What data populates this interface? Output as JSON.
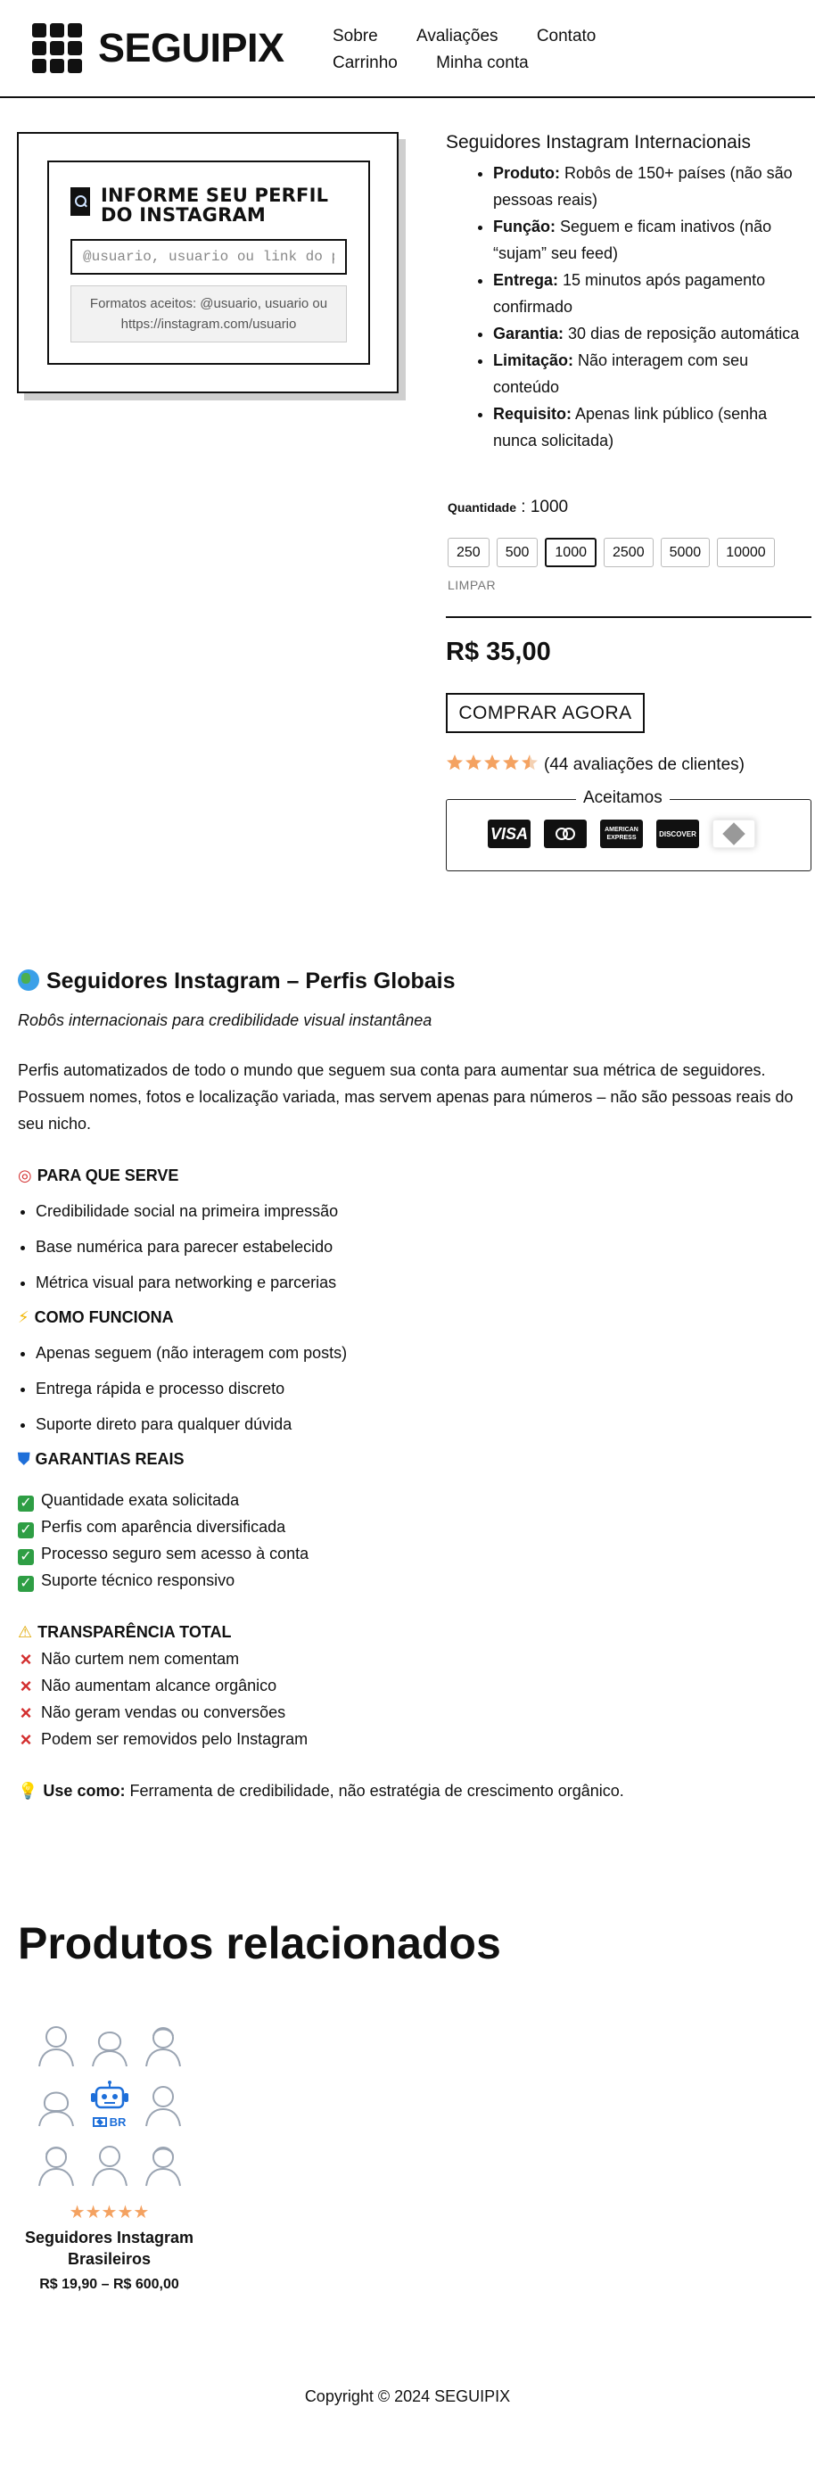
{
  "header": {
    "brand": "SEGUIPIX",
    "nav": [
      "Sobre",
      "Avaliações",
      "Contato",
      "Carrinho",
      "Minha conta"
    ]
  },
  "profile_box": {
    "title": "INFORME SEU PERFIL DO INSTAGRAM",
    "input_placeholder": "@usuario, usuario ou link do perfil",
    "formats_line1": "Formatos aceitos: @usuario, usuario ou",
    "formats_line2": "https://instagram.com/usuario"
  },
  "product": {
    "title": "Seguidores Instagram Internacionais",
    "features": [
      {
        "label": "Produto:",
        "text": "Robôs de 150+ países (não são pessoas reais)"
      },
      {
        "label": "Função:",
        "text": "Seguem e ficam inativos (não “sujam” seu feed)"
      },
      {
        "label": "Entrega:",
        "text": "15 minutos após pagamento confirmado"
      },
      {
        "label": "Garantia:",
        "text": "30 dias de reposição automática"
      },
      {
        "label": "Limitação:",
        "text": "Não interagem com seu conteúdo"
      },
      {
        "label": "Requisito:",
        "text": "Apenas link público (senha nunca solicitada)"
      }
    ],
    "quantity_label": "Quantidade",
    "quantity_value": "1000",
    "quantity_options": [
      "250",
      "500",
      "1000",
      "2500",
      "5000",
      "10000"
    ],
    "selected_quantity": "1000",
    "clear_label": "LIMPAR",
    "price": "R$ 35,00",
    "buy_label": "COMPRAR AGORA",
    "rating_stars": 4.5,
    "rating_text": "(44 avaliações de clientes)",
    "accept_title": "Aceitamos",
    "payment_cards": [
      {
        "name": "visa-card-icon",
        "text": "VISA"
      },
      {
        "name": "mastercard-icon",
        "text": "MasterCard"
      },
      {
        "name": "amex-card-icon",
        "text": "AMERICAN EXPRESS"
      },
      {
        "name": "discover-card-icon",
        "text": "DISCOVER"
      },
      {
        "name": "pix-icon",
        "text": ""
      }
    ]
  },
  "description": {
    "heading": "Seguidores Instagram – Perfis Globais",
    "tagline": "Robôs internacionais para credibilidade visual instantânea",
    "intro": "Perfis automatizados de todo o mundo que seguem sua conta para aumentar sua métrica de seguidores. Possuem nomes, fotos e localização variada, mas servem apenas para números – não são pessoas reais do seu nicho.",
    "purpose_title": "PARA QUE SERVE",
    "purpose_items": [
      "Credibilidade social na primeira impressão",
      "Base numérica para parecer estabelecido",
      "Métrica visual para networking e parcerias"
    ],
    "how_title": "COMO FUNCIONA",
    "how_items": [
      "Apenas seguem (não interagem com posts)",
      "Entrega rápida e processo discreto",
      "Suporte direto para qualquer dúvida"
    ],
    "guarantee_title": "GARANTIAS REAIS",
    "guarantee_items": [
      "Quantidade exata solicitada",
      "Perfis com aparência diversificada",
      "Processo seguro sem acesso à conta",
      "Suporte técnico responsivo"
    ],
    "transparency_title": "TRANSPARÊNCIA TOTAL",
    "transparency_items": [
      "Não curtem nem comentam",
      "Não aumentam alcance orgânico",
      "Não geram vendas ou conversões",
      "Podem ser removidos pelo Instagram"
    ],
    "use_label": "Use como:",
    "use_text": "Ferramenta de credibilidade, não estratégia de crescimento orgânico."
  },
  "related": {
    "title": "Produtos relacionados",
    "product_name": "Seguidores Instagram Brasileiros",
    "product_price": "R$ 19,90 – R$ 600,00",
    "product_rating": 5,
    "badge_text": "BR"
  },
  "footer": {
    "copyright": "Copyright © 2024 SEGUIPIX"
  },
  "colors": {
    "accent": "#111111",
    "star": "#f4a261",
    "check": "#2e9e44",
    "cross": "#d32f2f",
    "robot_blue": "#1e6fd9",
    "avatar_gray": "#9aa4b2"
  }
}
